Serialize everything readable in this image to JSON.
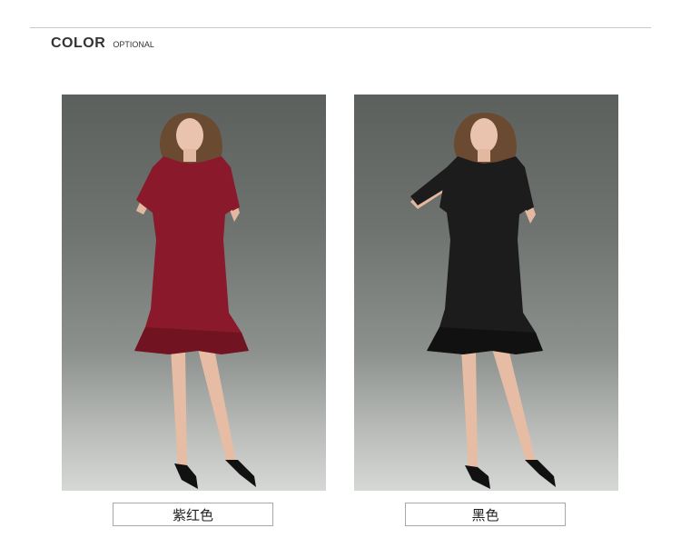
{
  "header": {
    "title": "COLOR",
    "subtitle": "OPTIONAL"
  },
  "options": [
    {
      "label": "紫红色",
      "dress_color": "#8a1a2b",
      "dress_shade": "#5e0f1c"
    },
    {
      "label": "黑色",
      "dress_color": "#1c1c1c",
      "dress_shade": "#0a0a0a"
    }
  ]
}
